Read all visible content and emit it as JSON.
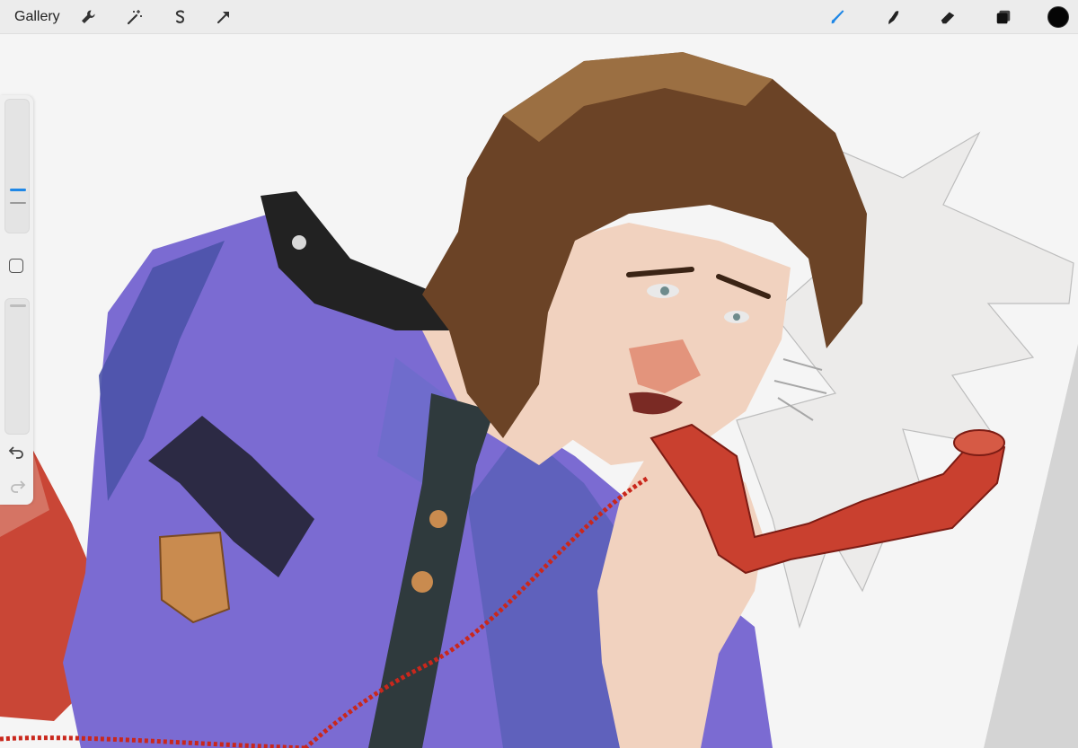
{
  "toolbar": {
    "gallery_label": "Gallery",
    "left_tools": [
      "wrench-icon",
      "magic-wand-icon",
      "selection-icon",
      "transform-icon"
    ],
    "right_tools": [
      "brush-icon",
      "smudge-icon",
      "eraser-icon",
      "layers-icon"
    ],
    "active_tool": "brush-icon",
    "active_color": "#050505",
    "accent_color": "#1f87e6"
  },
  "sidebar": {
    "controls": [
      "brush-size-slider",
      "modify-button",
      "opacity-slider",
      "undo-button",
      "redo-button"
    ]
  },
  "canvas": {
    "palette": {
      "jacket": "#7b6bd2",
      "jacket_shadow": "#4b53a8",
      "hair": "#6b4326",
      "skin": "#f1d2bf",
      "phone": "#c9402f",
      "tie": "#2f3a3d",
      "burst": "#ecebea"
    }
  }
}
